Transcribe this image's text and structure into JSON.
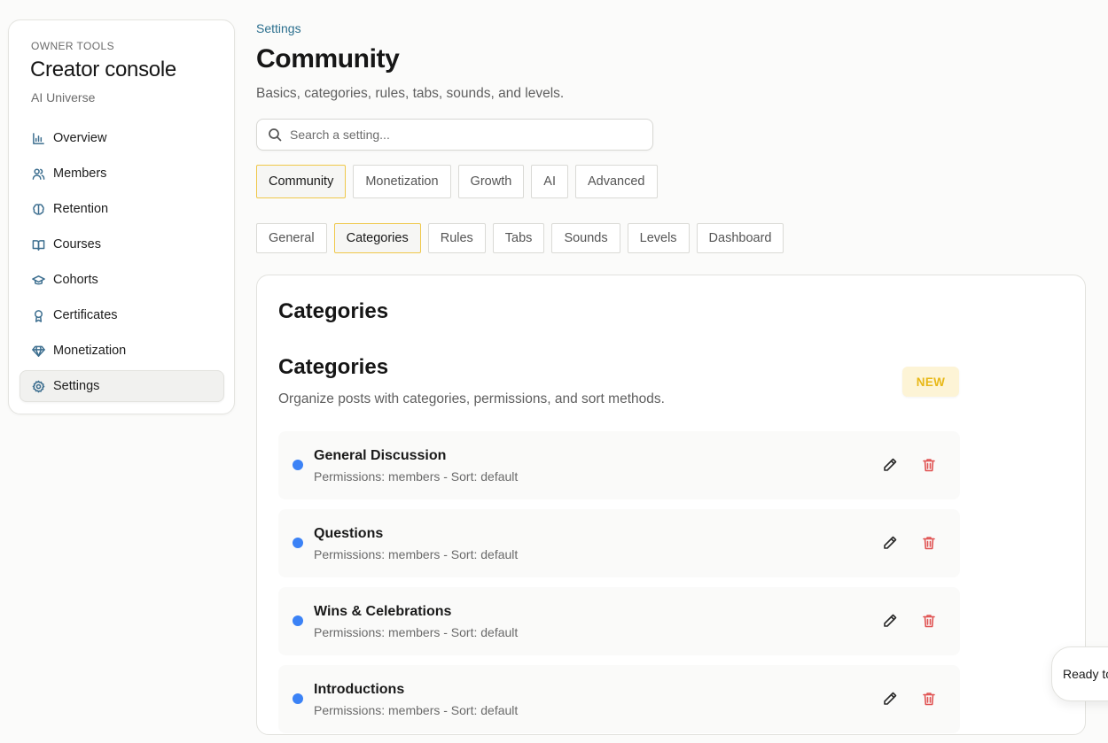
{
  "sidebar": {
    "section_label": "OWNER TOOLS",
    "title": "Creator console",
    "workspace": "AI Universe",
    "items": [
      {
        "label": "Overview",
        "icon": "bar-chart-icon"
      },
      {
        "label": "Members",
        "icon": "users-icon"
      },
      {
        "label": "Retention",
        "icon": "brain-icon"
      },
      {
        "label": "Courses",
        "icon": "book-open-icon"
      },
      {
        "label": "Cohorts",
        "icon": "graduation-cap-icon"
      },
      {
        "label": "Certificates",
        "icon": "award-icon"
      },
      {
        "label": "Monetization",
        "icon": "gem-icon"
      },
      {
        "label": "Settings",
        "icon": "gear-icon",
        "active": true
      }
    ]
  },
  "header": {
    "breadcrumb": "Settings",
    "title": "Community",
    "subtitle": "Basics, categories, rules, tabs, sounds, and levels."
  },
  "search": {
    "placeholder": "Search a setting...",
    "value": ""
  },
  "primary_tabs": [
    {
      "label": "Community",
      "active": true
    },
    {
      "label": "Monetization"
    },
    {
      "label": "Growth"
    },
    {
      "label": "AI"
    },
    {
      "label": "Advanced"
    }
  ],
  "secondary_tabs": [
    {
      "label": "General"
    },
    {
      "label": "Categories",
      "active": true
    },
    {
      "label": "Rules"
    },
    {
      "label": "Tabs"
    },
    {
      "label": "Sounds"
    },
    {
      "label": "Levels"
    },
    {
      "label": "Dashboard"
    }
  ],
  "panel": {
    "title": "Categories",
    "section_title": "Categories",
    "section_description": "Organize posts with categories, permissions, and sort methods.",
    "badge": "NEW",
    "categories": [
      {
        "name": "General Discussion",
        "meta": "Permissions: members - Sort: default",
        "color": "#3b82f6"
      },
      {
        "name": "Questions",
        "meta": "Permissions: members - Sort: default",
        "color": "#3b82f6"
      },
      {
        "name": "Wins & Celebrations",
        "meta": "Permissions: members - Sort: default",
        "color": "#3b82f6"
      },
      {
        "name": "Introductions",
        "meta": "Permissions: members - Sort: default",
        "color": "#3b82f6"
      }
    ]
  },
  "toast": {
    "text": "Ready to"
  },
  "colors": {
    "accent": "#2b6f8e",
    "active_tab_border": "#efc84a",
    "badge_bg": "#fdf4d6",
    "badge_text": "#e8b817",
    "delete": "#e05252",
    "category_dot": "#3b82f6"
  }
}
